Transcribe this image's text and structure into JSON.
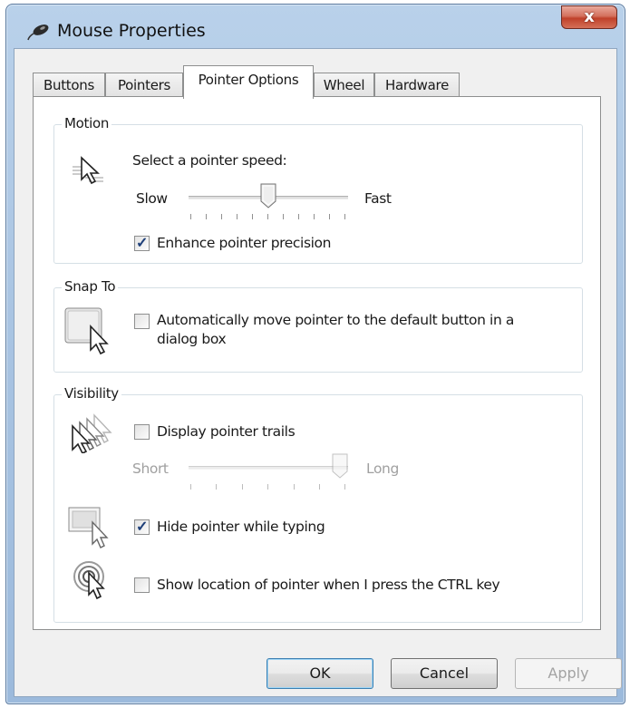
{
  "window": {
    "title": "Mouse Properties",
    "close_glyph": "x"
  },
  "tabs": [
    {
      "label": "Buttons"
    },
    {
      "label": "Pointers"
    },
    {
      "label": "Pointer Options"
    },
    {
      "label": "Wheel"
    },
    {
      "label": "Hardware"
    }
  ],
  "active_tab": "Pointer Options",
  "motion": {
    "title": "Motion",
    "speed_label": "Select a pointer speed:",
    "slow_label": "Slow",
    "fast_label": "Fast",
    "speed_value": 0.5,
    "enhance_label": "Enhance pointer precision",
    "enhance_checked": true
  },
  "snap": {
    "title": "Snap To",
    "line1": "Automatically move pointer to the default button in a",
    "line2": "dialog box",
    "checked": false
  },
  "visibility": {
    "title": "Visibility",
    "trails_label": "Display pointer trails",
    "trails_checked": false,
    "short_label": "Short",
    "long_label": "Long",
    "trails_value": 1.0,
    "hide_label": "Hide pointer while typing",
    "hide_checked": true,
    "ctrl_label": "Show location of pointer when I press the CTRL key",
    "ctrl_checked": false
  },
  "buttons": {
    "ok": "OK",
    "cancel": "Cancel",
    "apply": "Apply"
  },
  "check_glyph": "✓"
}
